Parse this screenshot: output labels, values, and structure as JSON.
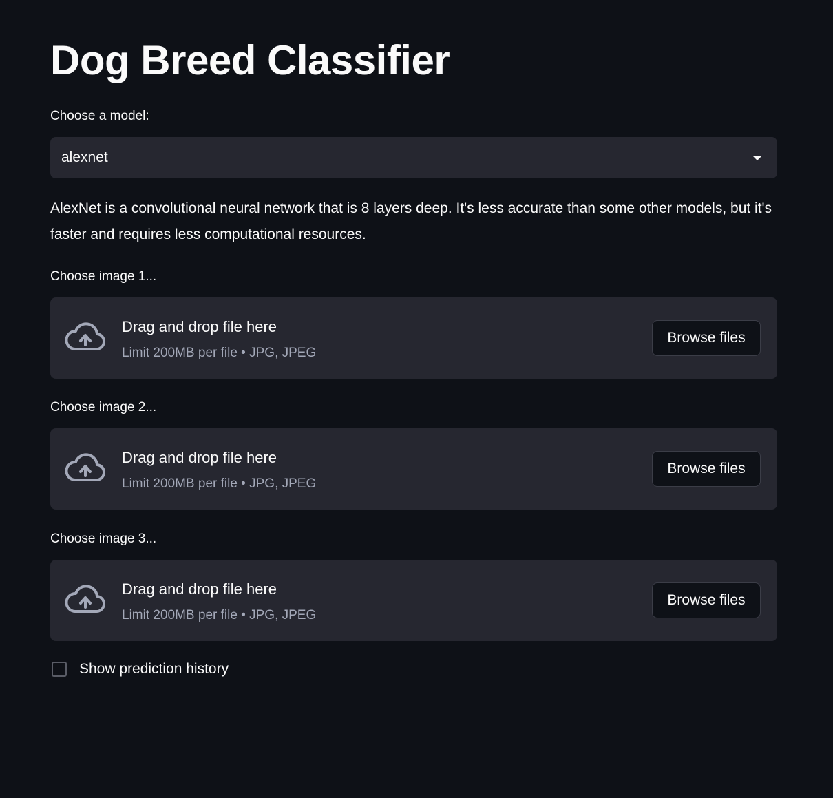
{
  "app": {
    "title": "Dog Breed Classifier"
  },
  "model_select": {
    "label": "Choose a model:",
    "selected": "alexnet"
  },
  "model_description": "AlexNet is a convolutional neural network that is 8 layers deep. It's less accurate than some other models, but it's faster and requires less computational resources.",
  "uploaders": [
    {
      "label": "Choose image 1...",
      "drop_text": "Drag and drop file here",
      "limit_text": "Limit 200MB per file • JPG, JPEG",
      "button_label": "Browse files"
    },
    {
      "label": "Choose image 2...",
      "drop_text": "Drag and drop file here",
      "limit_text": "Limit 200MB per file • JPG, JPEG",
      "button_label": "Browse files"
    },
    {
      "label": "Choose image 3...",
      "drop_text": "Drag and drop file here",
      "limit_text": "Limit 200MB per file • JPG, JPEG",
      "button_label": "Browse files"
    }
  ],
  "history_toggle": {
    "label": "Show prediction history",
    "checked": false
  },
  "icons": {
    "upload": "cloud-upload-icon",
    "dropdown": "chevron-down-icon"
  },
  "colors": {
    "background": "#0e1117",
    "surface": "#262730",
    "text": "#fafafa",
    "muted_text": "#a3a8b8",
    "icon": "#a3a8b8"
  }
}
